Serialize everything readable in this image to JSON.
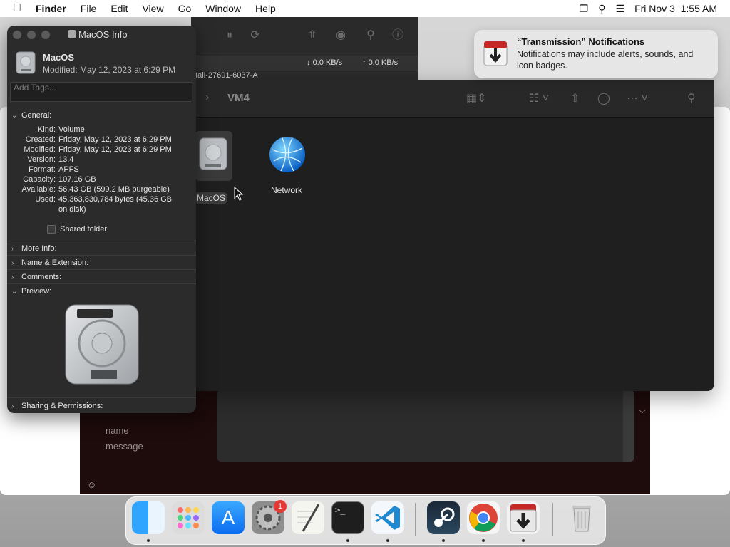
{
  "menubar": {
    "app": "Finder",
    "menus": [
      "File",
      "Edit",
      "View",
      "Go",
      "Window",
      "Help"
    ],
    "datetime": "Fri Nov 3  1:55 AM"
  },
  "chat": {
    "name_placeholder": "name",
    "message_placeholder": "message"
  },
  "transmission": {
    "download_rate": "0.0 KB/s",
    "upload_rate": "0.0 KB/s",
    "row_text": "etail-27691-6037-A"
  },
  "finder": {
    "title": "VM4",
    "items": [
      {
        "label": "MacOS",
        "selected": true
      },
      {
        "label": "Network",
        "selected": false
      }
    ]
  },
  "info": {
    "window_title": "MacOS Info",
    "name": "MacOS",
    "modified": "Modified: May 12, 2023 at 6:29 PM",
    "tags_placeholder": "Add Tags...",
    "sections": {
      "general": "General:",
      "more_info": "More Info:",
      "name_ext": "Name & Extension:",
      "comments": "Comments:",
      "preview": "Preview:",
      "sharing": "Sharing & Permissions:"
    },
    "general": {
      "kind_k": "Kind:",
      "kind_v": "Volume",
      "created_k": "Created:",
      "created_v": "Friday, May 12, 2023 at 6:29 PM",
      "modified_k": "Modified:",
      "modified_v": "Friday, May 12, 2023 at 6:29 PM",
      "version_k": "Version:",
      "version_v": "13.4",
      "format_k": "Format:",
      "format_v": "APFS",
      "capacity_k": "Capacity:",
      "capacity_v": "107.16 GB",
      "available_k": "Available:",
      "available_v": "56.43 GB (599.2 MB purgeable)",
      "used_k": "Used:",
      "used_v1": "45,363,830,784 bytes (45.36 GB",
      "used_v2": "on disk)"
    },
    "shared_folder_label": "Shared folder",
    "shared_folder_checked": false
  },
  "notification": {
    "title": "“Transmission” Notifications",
    "body": "Notifications may include alerts, sounds, and icon badges."
  },
  "dock": {
    "items": [
      "Finder",
      "Launchpad",
      "App Store",
      "System Settings",
      "TextEdit",
      "Terminal",
      "Visual Studio Code",
      "Steam",
      "Google Chrome",
      "Transmission",
      "Trash"
    ],
    "settings_badge": "1"
  },
  "colors": {
    "accent_blue": "#0a84ff",
    "badge_red": "#e53935",
    "dark_window": "#1f1f1f"
  }
}
